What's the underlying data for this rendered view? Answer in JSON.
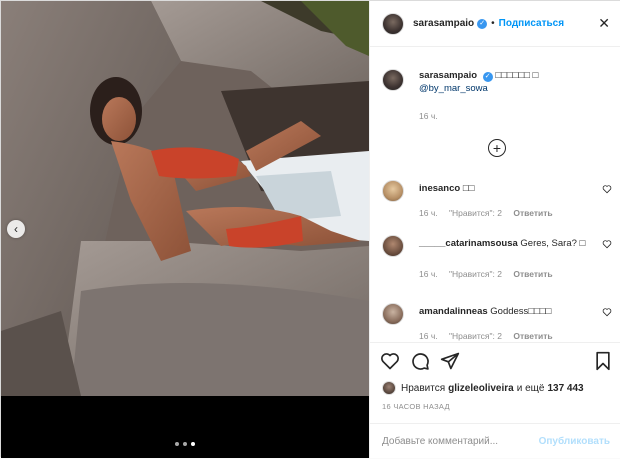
{
  "header": {
    "username": "sarasampaio",
    "separator": "•",
    "follow_label": "Подписаться",
    "close_glyph": "✕"
  },
  "caption": {
    "username": "sarasampaio",
    "text": "□□□□□□ □",
    "mention": "@by_mar_sowa",
    "time": "16 ч."
  },
  "load_more_glyph": "+",
  "comments": [
    {
      "username": "inesanco",
      "text": "□□",
      "time": "16 ч.",
      "likes": "\"Нравится\": 2",
      "reply": "Ответить"
    },
    {
      "username": "_____catarinamsousa",
      "text": "Geres, Sara? □",
      "time": "16 ч.",
      "likes": "\"Нравится\": 2",
      "reply": "Ответить"
    },
    {
      "username": "amandalinneas",
      "text": "Goddess□□□□",
      "time": "16 ч.",
      "likes": "\"Нравится\": 2",
      "reply": "Ответить"
    }
  ],
  "likes": {
    "prefix": "Нравится",
    "user": "glizeleoliveira",
    "suffix": "и ещё",
    "count": "137 443"
  },
  "posted_ago": "16 ЧАСОВ НАЗАД",
  "comment_box": {
    "placeholder": "Добавьте комментарий...",
    "publish_label": "Опубликовать"
  },
  "carousel": {
    "prev_glyph": "‹",
    "total_slides": 3,
    "active_slide": 3
  },
  "icons": {
    "like": "heart-icon",
    "comment": "comment-icon",
    "share": "share-icon",
    "save": "bookmark-icon"
  },
  "colors": {
    "accent": "#0095f6",
    "verified": "#3897f0",
    "publish_disabled": "#b2dffc",
    "muted": "#8e8e8e"
  }
}
